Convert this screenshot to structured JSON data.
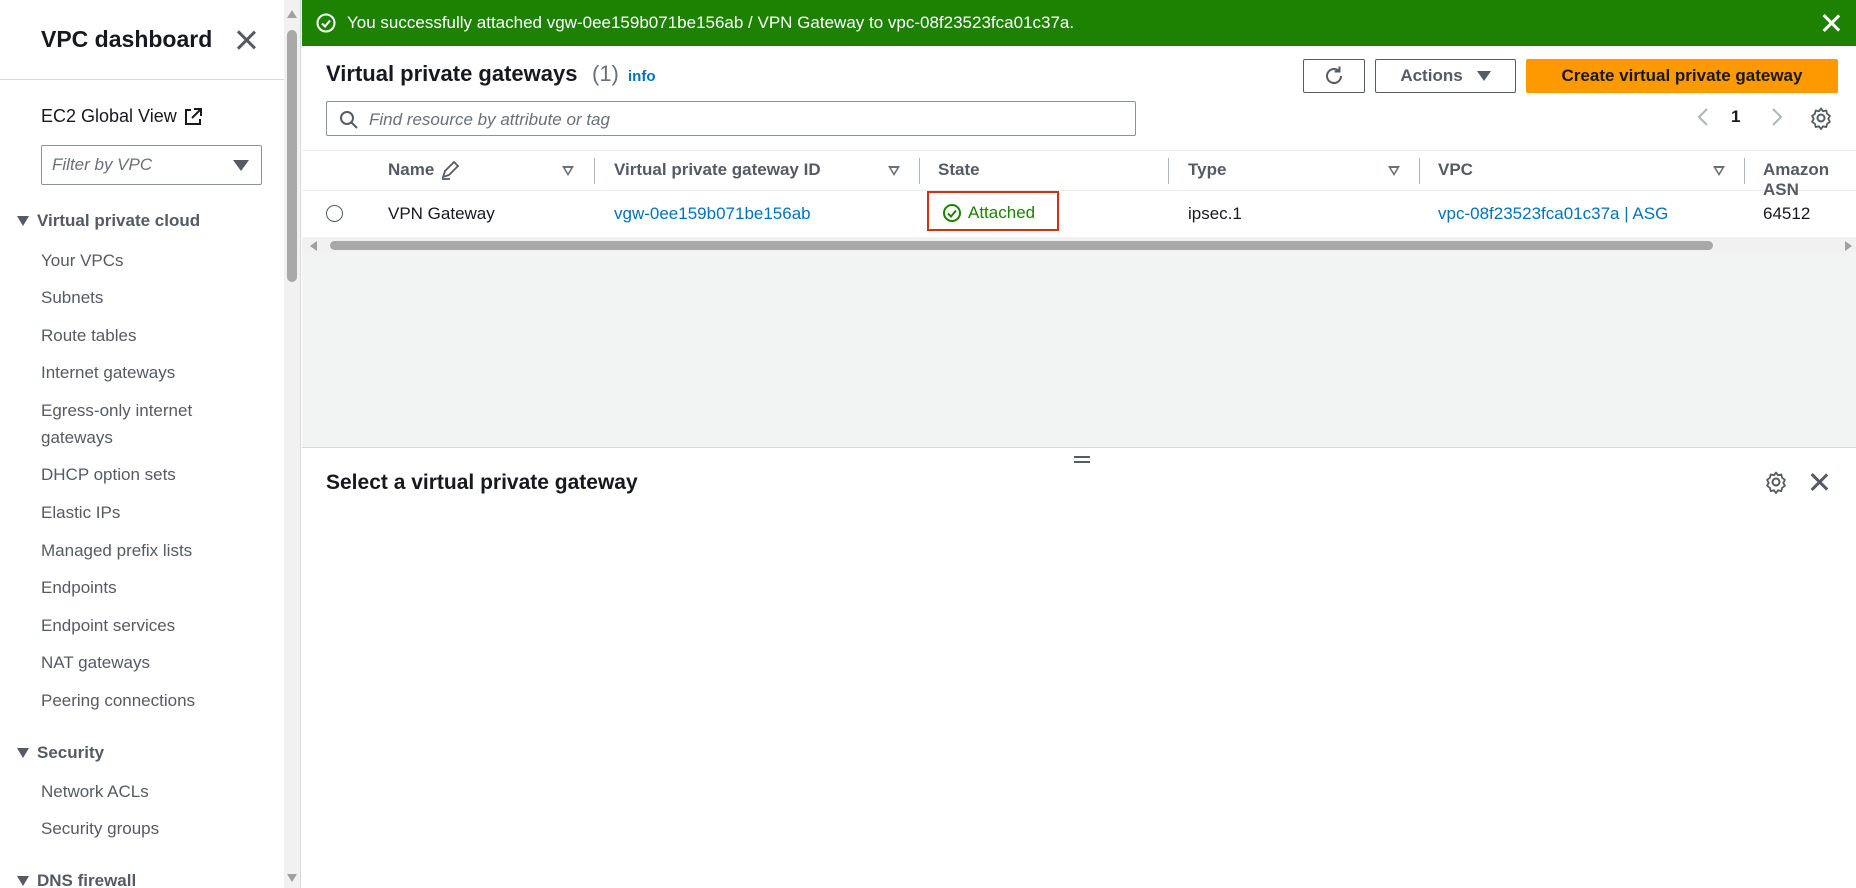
{
  "sidebar": {
    "title": "VPC dashboard",
    "ec2_link": "EC2 Global View",
    "filter_placeholder": "Filter by VPC",
    "sections": [
      {
        "label": "Virtual private cloud"
      },
      {
        "label": "Security"
      },
      {
        "label": "DNS firewall"
      }
    ],
    "vpc_items": [
      "Your VPCs",
      "Subnets",
      "Route tables",
      "Internet gateways",
      "Egress-only internet gateways",
      "DHCP option sets",
      "Elastic IPs",
      "Managed prefix lists",
      "Endpoints",
      "Endpoint services",
      "NAT gateways",
      "Peering connections"
    ],
    "security_items": [
      "Network ACLs",
      "Security groups"
    ]
  },
  "flash": {
    "message": "You successfully attached vgw-0ee159b071be156ab / VPN Gateway to vpc-08f23523fca01c37a.",
    "color": "#1d8102"
  },
  "header": {
    "title": "Virtual private gateways",
    "count": "(1)",
    "info": "info",
    "actions_label": "Actions",
    "create_label": "Create virtual private gateway",
    "search_placeholder": "Find resource by attribute or tag",
    "page": "1"
  },
  "table": {
    "columns": [
      "Name",
      "Virtual private gateway ID",
      "State",
      "Type",
      "VPC",
      "Amazon ASN"
    ],
    "rows": [
      {
        "name": "VPN Gateway",
        "id": "vgw-0ee159b071be156ab",
        "state": "Attached",
        "type": "ipsec.1",
        "vpc": "vpc-08f23523fca01c37a | ASG",
        "asn": "64512"
      }
    ]
  },
  "details": {
    "title": "Select a virtual private gateway"
  },
  "colors": {
    "accent": "#ff9900",
    "link": "#0073bb",
    "success": "#1d8102",
    "highlight": "#d13212"
  }
}
